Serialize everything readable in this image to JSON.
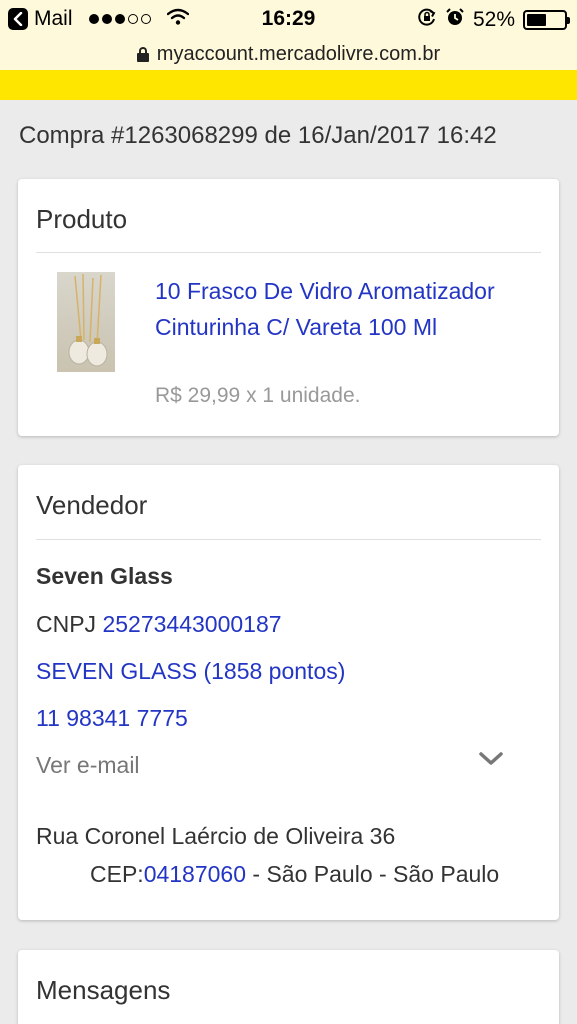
{
  "status_bar": {
    "back_app": "Mail",
    "time": "16:29",
    "battery": "52%",
    "battery_level": 0.52
  },
  "url_bar": {
    "url": "myaccount.mercadolivre.com.br"
  },
  "order": {
    "title": "Compra #1263068299 de 16/Jan/2017 16:42"
  },
  "produto": {
    "heading": "Produto",
    "item_title": "10 Frasco De Vidro Aromatizador Cinturinha C/ Vareta 100 Ml",
    "price_line": "R$ 29,99 x 1 unidade."
  },
  "vendedor": {
    "heading": "Vendedor",
    "name": "Seven Glass",
    "cnpj_label": "CNPJ ",
    "cnpj_value": "25273443000187",
    "store_link": "SEVEN GLASS (1858 pontos)",
    "phone": "11 98341 7775",
    "email_toggle": "Ver e-mail",
    "address": "Rua Coronel Laércio de Oliveira 36",
    "cep_label": "CEP:",
    "cep_value": "04187060",
    "cep_rest": " - São Paulo - São Paulo"
  },
  "mensagens": {
    "heading": "Mensagens"
  },
  "colors": {
    "brand_yellow": "#ffe600",
    "link_blue": "#2335c4",
    "status_bg": "#fff9db"
  }
}
